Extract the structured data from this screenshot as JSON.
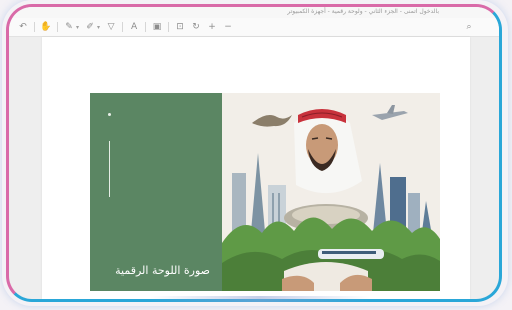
{
  "window": {
    "title": "بالدخول اتمنى - الجزء الثاني - ولوحة رقمية - أجهزة الكمبيوتر"
  },
  "toolbar": {
    "items": [
      {
        "name": "undo",
        "glyph": "↶"
      },
      {
        "name": "hand",
        "glyph": "✋"
      },
      {
        "name": "pen",
        "glyph": "✎"
      },
      {
        "name": "highlighter",
        "glyph": "✐"
      },
      {
        "name": "filter",
        "glyph": "▽"
      },
      {
        "name": "text",
        "glyph": "A"
      },
      {
        "name": "image",
        "glyph": "▣"
      },
      {
        "name": "fit",
        "glyph": "⊡"
      },
      {
        "name": "rotate",
        "glyph": "↻"
      },
      {
        "name": "zoom_in",
        "glyph": "+"
      },
      {
        "name": "zoom_out",
        "glyph": "−"
      }
    ],
    "search_glyph": "⌕"
  },
  "document": {
    "caption": "صورة اللوحة الرقمية"
  },
  "colors": {
    "frame_left": "#d96aa8",
    "frame_right": "#2aa7d8",
    "panel_green": "#5b8663"
  }
}
